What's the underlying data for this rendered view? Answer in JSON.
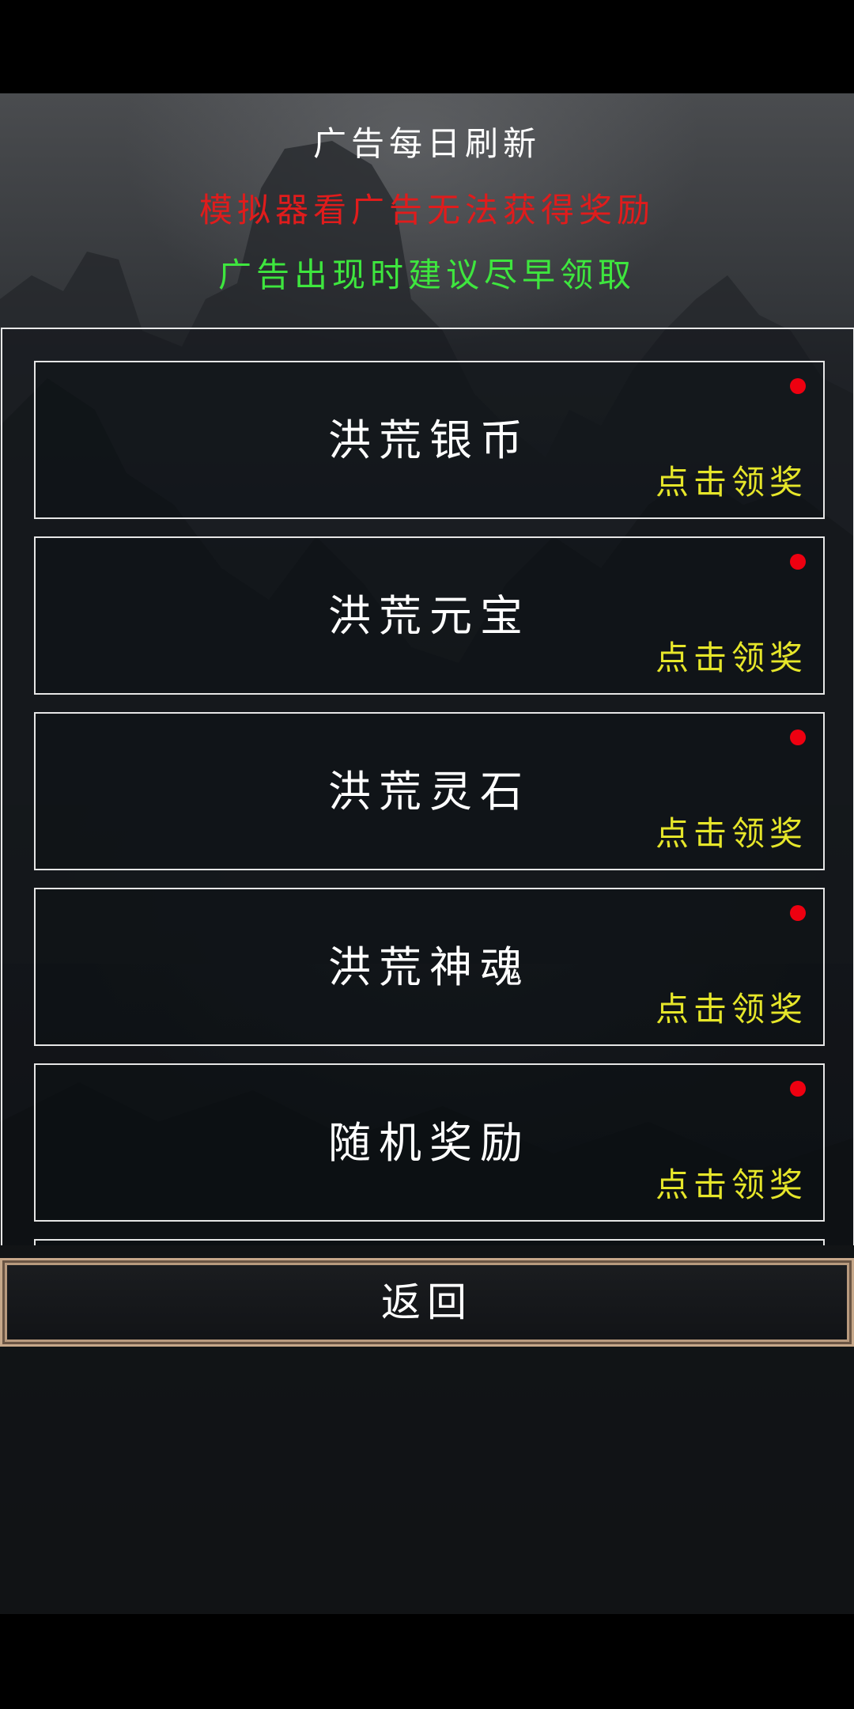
{
  "header": {
    "line1": "广告每日刷新",
    "line2": "模拟器看广告无法获得奖励",
    "line3": "广告出现时建议尽早领取"
  },
  "rewards": [
    {
      "name": "洪荒银币",
      "action": "点击领奖",
      "has_new": true
    },
    {
      "name": "洪荒元宝",
      "action": "点击领奖",
      "has_new": true
    },
    {
      "name": "洪荒灵石",
      "action": "点击领奖",
      "has_new": true
    },
    {
      "name": "洪荒神魂",
      "action": "点击领奖",
      "has_new": true
    },
    {
      "name": "随机奖励",
      "action": "点击领奖",
      "has_new": true
    }
  ],
  "back_button": {
    "label": "返回"
  },
  "colors": {
    "header_white": "#ffffff",
    "header_red": "#e01c1c",
    "header_green": "#3ee63e",
    "claim_yellow": "#e6e62a",
    "notify_red": "#ee0010"
  }
}
